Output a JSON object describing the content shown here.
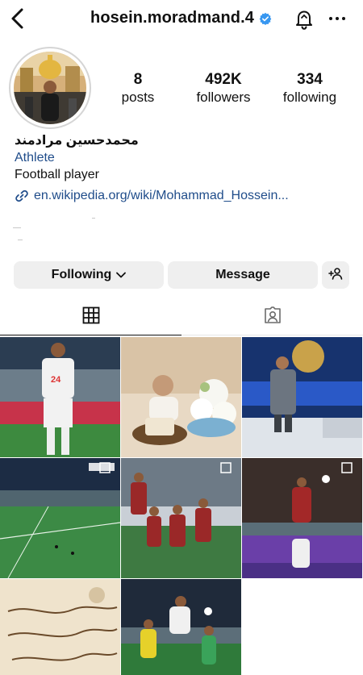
{
  "header": {
    "username": "hosein.moradmand.4",
    "icons": [
      "back-arrow-icon",
      "verified-badge-icon",
      "notification-bell-icon",
      "more-options-icon"
    ]
  },
  "stats": {
    "posts": {
      "value": "8",
      "label": "posts"
    },
    "followers": {
      "value": "492K",
      "label": "followers"
    },
    "following": {
      "value": "334",
      "label": "following"
    }
  },
  "profile": {
    "full_name": "محمدحسین مرادمند",
    "category": "Athlete",
    "bio": "Football player",
    "link": "en.wikipedia.org/wiki/Mohammad_Hossein..."
  },
  "actions": {
    "following_label": "Following",
    "message_label": "Message"
  },
  "tabs": [
    "posts-grid-icon",
    "tagged-icon"
  ],
  "colors": {
    "link_blue": "#1f4c8a",
    "button_bg": "#efefef",
    "verified_blue": "#3897f0"
  }
}
